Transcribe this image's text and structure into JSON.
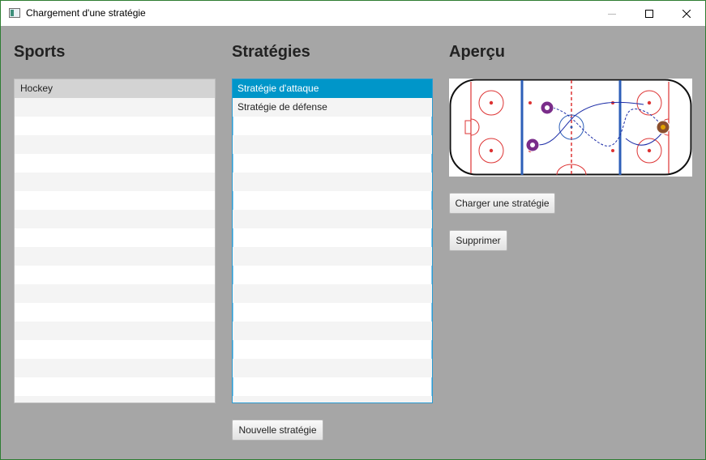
{
  "window": {
    "title": "Chargement d'une stratégie",
    "controls": [
      "minimize-icon",
      "maximize-icon",
      "close-icon"
    ]
  },
  "sports": {
    "heading": "Sports",
    "items": [
      "Hockey"
    ],
    "selected": "Hockey"
  },
  "strategies": {
    "heading": "Stratégies",
    "items": [
      "Stratégie d'attaque",
      "Stratégie de défense"
    ],
    "selected": "Stratégie d'attaque"
  },
  "preview": {
    "heading": "Aperçu",
    "image": "hockey-rink-strategy-preview"
  },
  "buttons": {
    "load": "Charger une stratégie",
    "delete": "Supprimer",
    "new": "Nouvelle stratégie"
  },
  "colors": {
    "background": "#a6a6a6",
    "selection_blue": "#0096c9",
    "selection_grey": "#d3d3d3",
    "focus_border": "#2a9bd3"
  }
}
